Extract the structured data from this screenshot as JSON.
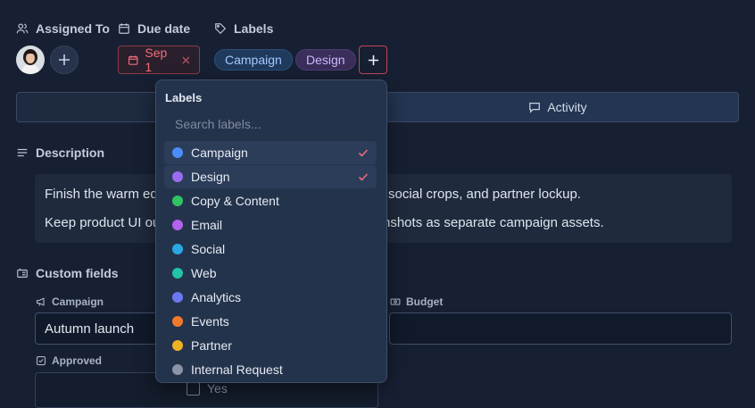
{
  "headers": {
    "assigned_to": "Assigned To",
    "due_date": "Due date",
    "labels": "Labels"
  },
  "due_date_value": "Sep 1",
  "applied_labels": [
    "Campaign",
    "Design"
  ],
  "tabs": {
    "activity": "Activity"
  },
  "description": {
    "header": "Description",
    "line1": "Finish the warm ed… social crops, and partner lockup.",
    "line1_left": "Finish the warm ed",
    "line1_right": "social crops, and partner lockup.",
    "line2_left": "Keep product UI ou",
    "line2_right": "nshots as separate campaign assets."
  },
  "custom_fields": {
    "header": "Custom fields",
    "campaign_label": "Campaign",
    "campaign_value": "Autumn launch",
    "budget_label": "Budget",
    "budget_value": "",
    "approved_label": "Approved",
    "approved_option": "Yes"
  },
  "labels_dropdown": {
    "title": "Labels",
    "search_placeholder": "Search labels...",
    "items": [
      {
        "name": "Campaign",
        "color": "#4c8ef7",
        "selected": true
      },
      {
        "name": "Design",
        "color": "#9b6cf0",
        "selected": true
      },
      {
        "name": "Copy & Content",
        "color": "#2fc463",
        "selected": false
      },
      {
        "name": "Email",
        "color": "#b362ec",
        "selected": false
      },
      {
        "name": "Social",
        "color": "#28a9e6",
        "selected": false
      },
      {
        "name": "Web",
        "color": "#22c3a6",
        "selected": false
      },
      {
        "name": "Analytics",
        "color": "#6b78f0",
        "selected": false
      },
      {
        "name": "Events",
        "color": "#f07a2c",
        "selected": false
      },
      {
        "name": "Partner",
        "color": "#ecb224",
        "selected": false
      },
      {
        "name": "Internal Request",
        "color": "#8a94a6",
        "selected": false
      }
    ]
  },
  "colors": {
    "background": "#172033",
    "accent_red": "#c74358",
    "check": "#e56b80"
  }
}
